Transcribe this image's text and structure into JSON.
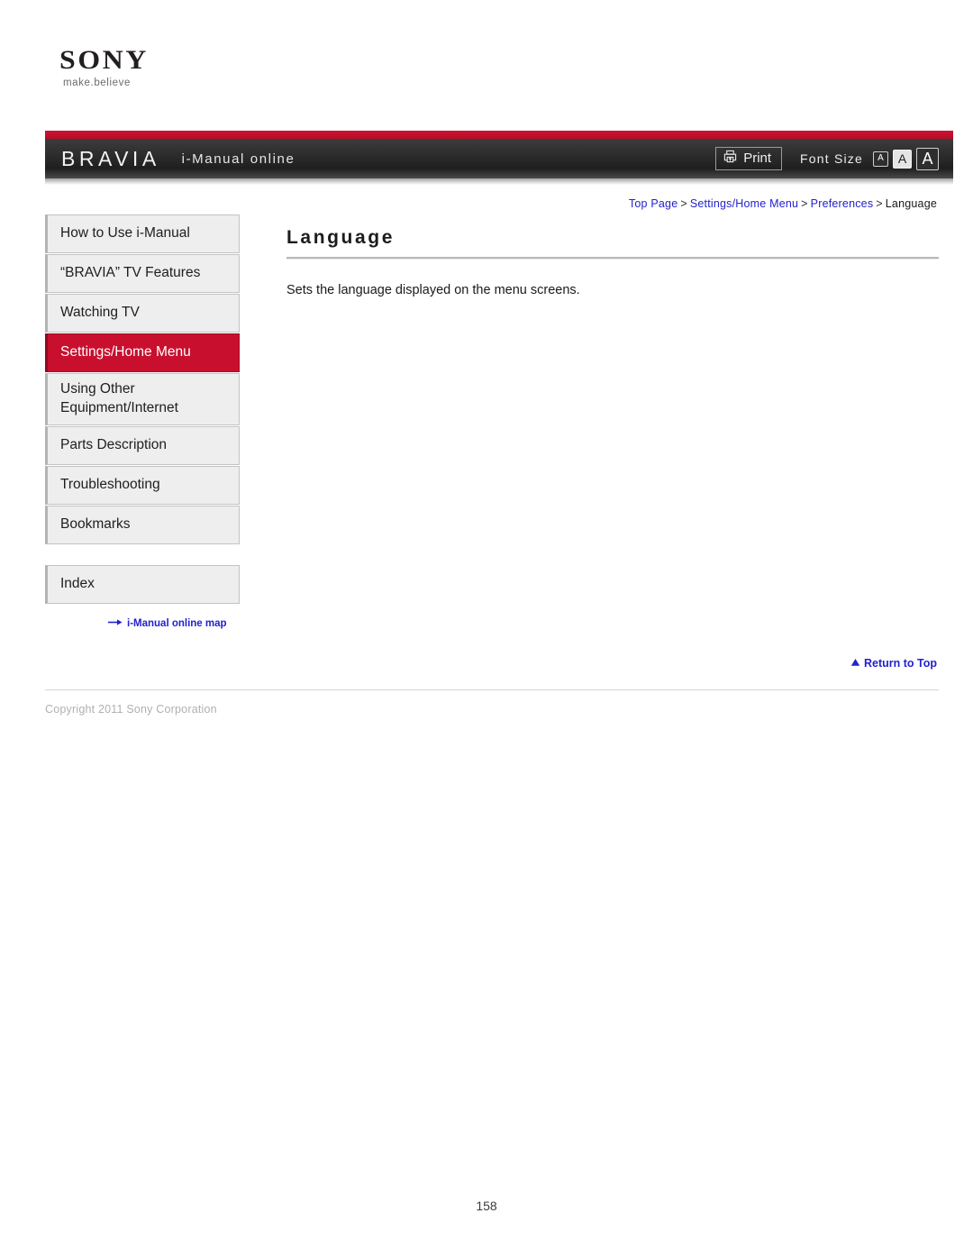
{
  "brand": {
    "logo_text": "SONY",
    "tagline": "make.believe"
  },
  "header": {
    "product": "BRAVIA",
    "title": "i-Manual online",
    "print_label": "Print",
    "print_icon": "printer-icon",
    "font_size_label": "Font Size",
    "font_sizes": [
      {
        "label": "A",
        "size": "small",
        "active": false
      },
      {
        "label": "A",
        "size": "medium",
        "active": true
      },
      {
        "label": "A",
        "size": "large",
        "active": false
      }
    ],
    "accent_color": "#c8102e"
  },
  "breadcrumb": {
    "separator": ">",
    "items": [
      {
        "label": "Top Page",
        "link": true
      },
      {
        "label": "Settings/Home Menu",
        "link": true
      },
      {
        "label": "Preferences",
        "link": true
      },
      {
        "label": "Language",
        "link": false
      }
    ],
    "link_color": "#2222cc"
  },
  "sidebar": {
    "items": [
      {
        "label": "How to Use i-Manual",
        "active": false
      },
      {
        "label": "“BRAVIA” TV Features",
        "active": false
      },
      {
        "label": "Watching TV",
        "active": false
      },
      {
        "label": "Settings/Home Menu",
        "active": true
      },
      {
        "label": "Using Other Equipment/Internet",
        "active": false
      },
      {
        "label": "Parts Description",
        "active": false
      },
      {
        "label": "Troubleshooting",
        "active": false
      },
      {
        "label": "Bookmarks",
        "active": false
      }
    ],
    "index_label": "Index",
    "map_link": {
      "label": "i-Manual online map",
      "icon": "arrow-right-icon"
    },
    "active_color": "#c8102e",
    "item_background": "#eeeeee"
  },
  "main": {
    "title": "Language",
    "body": "Sets the language displayed on the menu screens."
  },
  "footer": {
    "return_to_top": "Return to Top",
    "return_icon": "triangle-up-icon",
    "copyright": "Copyright 2011 Sony Corporation"
  },
  "page": {
    "number": "158"
  }
}
